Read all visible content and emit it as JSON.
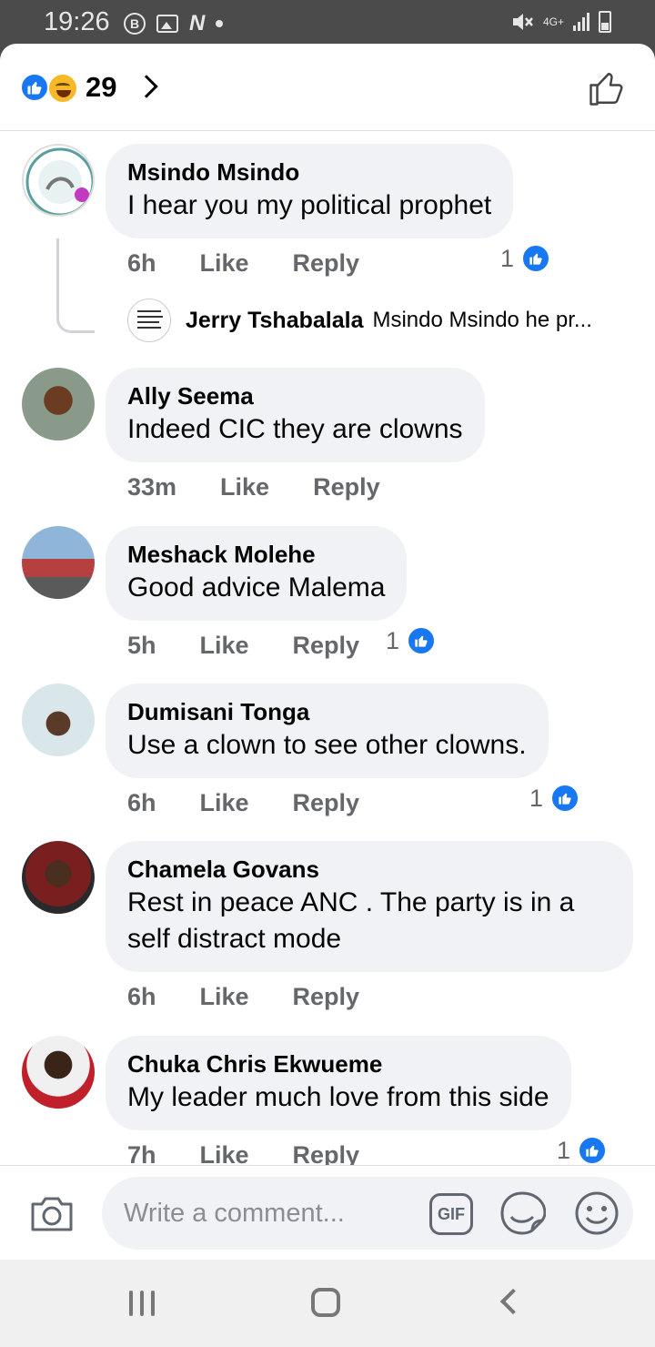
{
  "status_bar": {
    "time": "19:26",
    "badge_letter": "B",
    "network": "4G+"
  },
  "header": {
    "reaction_count": "29"
  },
  "comments": [
    {
      "name": "Msindo Msindo",
      "text": "I hear you my political prophet",
      "time": "6h",
      "like": "Like",
      "reply": "Reply",
      "likes": "1"
    },
    {
      "name": "Ally Seema",
      "text": "Indeed CIC they are clowns",
      "time": "33m",
      "like": "Like",
      "reply": "Reply"
    },
    {
      "name": "Meshack Molehe",
      "text": "Good advice Malema",
      "time": "5h",
      "like": "Like",
      "reply": "Reply",
      "likes": "1"
    },
    {
      "name": "Dumisani Tonga",
      "text": "Use a clown to see other clowns.",
      "time": "6h",
      "like": "Like",
      "reply": "Reply",
      "likes": "1"
    },
    {
      "name": "Chamela Govans",
      "text": "Rest in peace ANC . The party is in a self distract mode",
      "time": "6h",
      "like": "Like",
      "reply": "Reply"
    },
    {
      "name": "Chuka Chris Ekwueme",
      "text": "My leader much love from this side",
      "time": "7h",
      "like": "Like",
      "reply": "Reply",
      "likes": "1"
    }
  ],
  "reply_preview": {
    "name": "Jerry Tshabalala",
    "text": "Msindo Msindo he pr..."
  },
  "composer": {
    "placeholder": "Write a comment...",
    "gif_label": "GIF"
  },
  "colors": {
    "accent": "#1877f2",
    "bubble": "#f0f2f5",
    "secondary_text": "#65676b"
  }
}
